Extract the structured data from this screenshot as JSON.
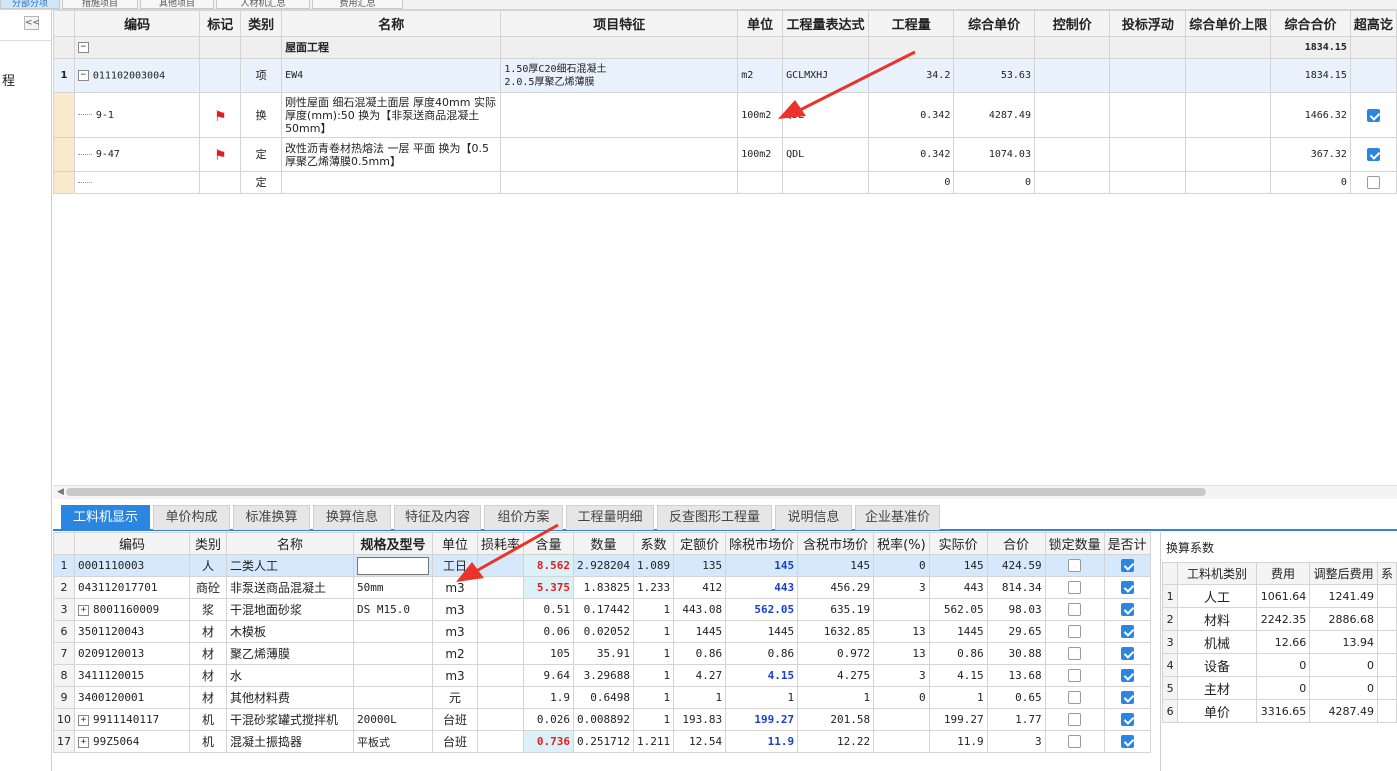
{
  "top_tabs": [
    "分部分项",
    "措施项目",
    "其他项目",
    "人材机汇总",
    "费用汇总"
  ],
  "left_panel": {
    "collapse_label": "<<",
    "partial_text": "程"
  },
  "upper_grid": {
    "headers": [
      "编码",
      "标记",
      "类别",
      "名称",
      "项目特征",
      "单位",
      "工程量表达式",
      "工程量",
      "综合单价",
      "控制价",
      "投标浮动",
      "综合单价上限",
      "综合合价",
      "超高讫"
    ],
    "group_row": {
      "toggle": "−",
      "name": "屋面工程",
      "total": "1834.15"
    },
    "item_row": {
      "row": "1",
      "toggle": "−",
      "code": "011102003004",
      "type": "项",
      "name": "EW4",
      "feature": "1.50厚C20细石混凝土\n2.0.5厚聚乙烯薄膜",
      "unit": "m2",
      "expr": "GCLMXHJ",
      "qty": "34.2",
      "price": "53.63",
      "total": "1834.15"
    },
    "sub_rows": [
      {
        "code": "9-1",
        "flag": "⚑",
        "type": "换",
        "name": "刚性屋面 细石混凝土面层 厚度40mm 实际厚度(mm):50 换为【非泵送商品混凝土50mm】",
        "unit": "100m2",
        "expr": "QDL",
        "qty": "0.342",
        "price": "4287.49",
        "total": "1466.32",
        "checked": true
      },
      {
        "code": "9-47",
        "flag": "⚑",
        "type": "定",
        "name": "改性沥青卷材热熔法 一层 平面 换为【0.5厚聚乙烯薄膜0.5mm】",
        "unit": "100m2",
        "expr": "QDL",
        "qty": "0.342",
        "price": "1074.03",
        "total": "367.32",
        "checked": true
      },
      {
        "code": "",
        "flag": "",
        "type": "定",
        "name": "",
        "unit": "",
        "expr": "",
        "qty": "0",
        "price": "0",
        "total": "0",
        "checked": false
      }
    ]
  },
  "bottom_tabs": [
    "工料机显示",
    "单价构成",
    "标准换算",
    "换算信息",
    "特征及内容",
    "组价方案",
    "工程量明细",
    "反查图形工程量",
    "说明信息",
    "企业基准价"
  ],
  "lower_grid": {
    "headers": [
      "编码",
      "类别",
      "名称",
      "规格及型号",
      "单位",
      "损耗率",
      "含量",
      "数量",
      "系数",
      "定额价",
      "除税市场价",
      "含税市场价",
      "税率(%)",
      "实际价",
      "合价",
      "锁定数量",
      "是否计"
    ],
    "rows": [
      {
        "rn": "1",
        "exp": "",
        "code": "0001110003",
        "type": "人",
        "name": "二类人工",
        "spec": "",
        "unit": "工日",
        "loss": "",
        "content": "8.562",
        "qty": "2.928204",
        "coef": "1.089",
        "quota": "135",
        "mkt": "145",
        "mkt_tax": "145",
        "rate": "0",
        "real": "145",
        "total": "424.59",
        "lock": false,
        "calc": true
      },
      {
        "rn": "2",
        "exp": "",
        "code": "043112017701",
        "type": "商砼",
        "name": "非泵送商品混凝土",
        "spec": "50mm",
        "unit": "m3",
        "loss": "",
        "content": "5.375",
        "qty": "1.83825",
        "coef": "1.233",
        "quota": "412",
        "mkt": "443",
        "mkt_tax": "456.29",
        "rate": "3",
        "real": "443",
        "total": "814.34",
        "lock": false,
        "calc": true
      },
      {
        "rn": "3",
        "exp": "+",
        "code": "8001160009",
        "type": "浆",
        "name": "干混地面砂浆",
        "spec": "DS M15.0",
        "unit": "m3",
        "loss": "",
        "content": "0.51",
        "qty": "0.17442",
        "coef": "1",
        "quota": "443.08",
        "mkt": "562.05",
        "mkt_tax": "635.19",
        "rate": "",
        "real": "562.05",
        "total": "98.03",
        "lock": false,
        "calc": true
      },
      {
        "rn": "6",
        "exp": "",
        "code": "3501120043",
        "type": "材",
        "name": "木模板",
        "spec": "",
        "unit": "m3",
        "loss": "",
        "content": "0.06",
        "qty": "0.02052",
        "coef": "1",
        "quota": "1445",
        "mkt": "1445",
        "mkt_tax": "1632.85",
        "rate": "13",
        "real": "1445",
        "total": "29.65",
        "lock": false,
        "calc": true
      },
      {
        "rn": "7",
        "exp": "",
        "code": "0209120013",
        "type": "材",
        "name": "聚乙烯薄膜",
        "spec": "",
        "unit": "m2",
        "loss": "",
        "content": "105",
        "qty": "35.91",
        "coef": "1",
        "quota": "0.86",
        "mkt": "0.86",
        "mkt_tax": "0.972",
        "rate": "13",
        "real": "0.86",
        "total": "30.88",
        "lock": false,
        "calc": true
      },
      {
        "rn": "8",
        "exp": "",
        "code": "3411120015",
        "type": "材",
        "name": "水",
        "spec": "",
        "unit": "m3",
        "loss": "",
        "content": "9.64",
        "qty": "3.29688",
        "coef": "1",
        "quota": "4.27",
        "mkt": "4.15",
        "mkt_tax": "4.275",
        "rate": "3",
        "real": "4.15",
        "total": "13.68",
        "lock": false,
        "calc": true
      },
      {
        "rn": "9",
        "exp": "",
        "code": "3400120001",
        "type": "材",
        "name": "其他材料费",
        "spec": "",
        "unit": "元",
        "loss": "",
        "content": "1.9",
        "qty": "0.6498",
        "coef": "1",
        "quota": "1",
        "mkt": "1",
        "mkt_tax": "1",
        "rate": "0",
        "real": "1",
        "total": "0.65",
        "lock": false,
        "calc": true
      },
      {
        "rn": "10",
        "exp": "+",
        "code": "9911140117",
        "type": "机",
        "name": "干混砂浆罐式搅拌机",
        "spec": "20000L",
        "unit": "台班",
        "loss": "",
        "content": "0.026",
        "qty": "0.008892",
        "coef": "1",
        "quota": "193.83",
        "mkt": "199.27",
        "mkt_tax": "201.58",
        "rate": "",
        "real": "199.27",
        "total": "1.77",
        "lock": false,
        "calc": true
      },
      {
        "rn": "17",
        "exp": "+",
        "code": "99Z5064",
        "type": "机",
        "name": "混凝土振捣器",
        "spec": "平板式",
        "unit": "台班",
        "loss": "",
        "content": "0.736",
        "qty": "0.251712",
        "coef": "1.211",
        "quota": "12.54",
        "mkt": "11.9",
        "mkt_tax": "12.22",
        "rate": "",
        "real": "11.9",
        "total": "3",
        "lock": false,
        "calc": true
      }
    ]
  },
  "coef_panel": {
    "title": "换算系数",
    "headers": [
      "工料机类别",
      "费用",
      "调整后费用",
      "系"
    ],
    "rows": [
      {
        "rn": "1",
        "cat": "人工",
        "fee": "1061.64",
        "adj": "1241.49"
      },
      {
        "rn": "2",
        "cat": "材料",
        "fee": "2242.35",
        "adj": "2886.68"
      },
      {
        "rn": "3",
        "cat": "机械",
        "fee": "12.66",
        "adj": "13.94"
      },
      {
        "rn": "4",
        "cat": "设备",
        "fee": "0",
        "adj": "0"
      },
      {
        "rn": "5",
        "cat": "主材",
        "fee": "0",
        "adj": "0"
      },
      {
        "rn": "6",
        "cat": "单价",
        "fee": "3316.65",
        "adj": "4287.49"
      }
    ]
  },
  "colors": {
    "accent": "#2a86e0",
    "flag": "#e02020",
    "arrow": "#e8342a",
    "highlight_red": "#e0201e",
    "highlight_blue": "#1a3fd0"
  }
}
